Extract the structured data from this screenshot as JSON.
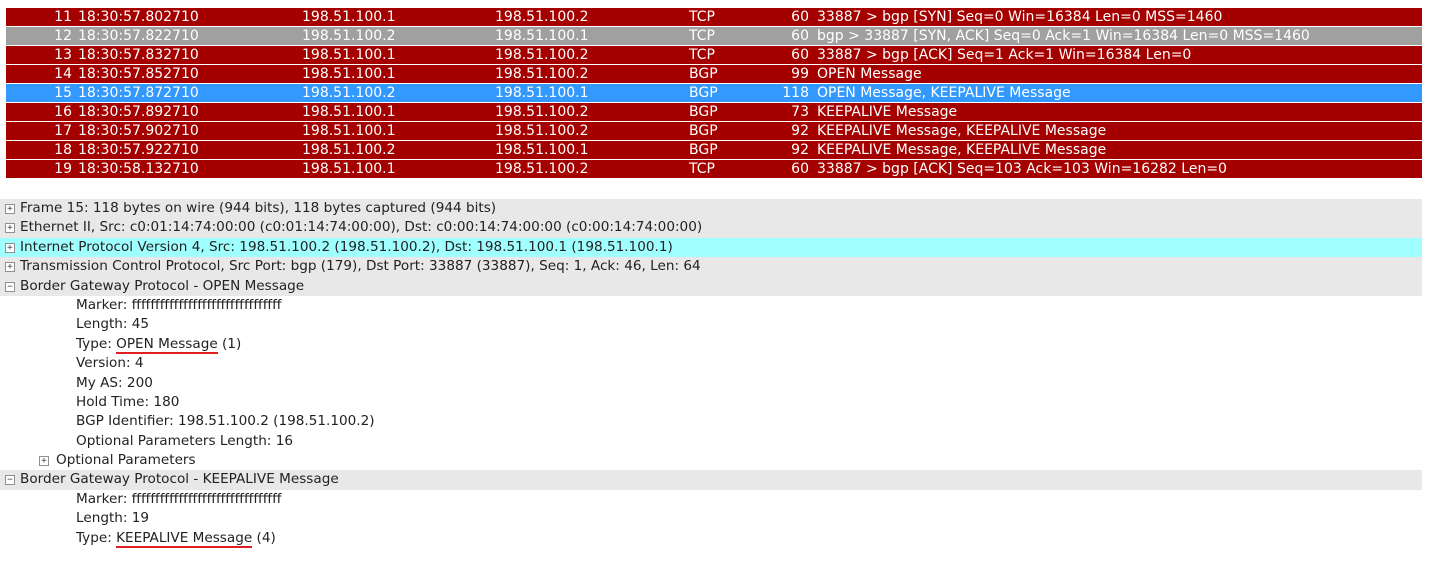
{
  "packets": [
    {
      "no": "11",
      "time": "18:30:57.802710",
      "src": "198.51.100.1",
      "dst": "198.51.100.2",
      "proto": "TCP",
      "len": "60",
      "info": "33887 > bgp [SYN] Seq=0 Win=16384 Len=0 MSS=1460"
    },
    {
      "no": "12",
      "time": "18:30:57.822710",
      "src": "198.51.100.2",
      "dst": "198.51.100.1",
      "proto": "TCP",
      "len": "60",
      "info": "bgp > 33887 [SYN, ACK] Seq=0 Ack=1 Win=16384 Len=0 MSS=1460"
    },
    {
      "no": "13",
      "time": "18:30:57.832710",
      "src": "198.51.100.1",
      "dst": "198.51.100.2",
      "proto": "TCP",
      "len": "60",
      "info": "33887 > bgp [ACK] Seq=1 Ack=1 Win=16384 Len=0"
    },
    {
      "no": "14",
      "time": "18:30:57.852710",
      "src": "198.51.100.1",
      "dst": "198.51.100.2",
      "proto": "BGP",
      "len": "99",
      "info": "OPEN Message"
    },
    {
      "no": "15",
      "time": "18:30:57.872710",
      "src": "198.51.100.2",
      "dst": "198.51.100.1",
      "proto": "BGP",
      "len": "118",
      "info": "OPEN Message, KEEPALIVE Message"
    },
    {
      "no": "16",
      "time": "18:30:57.892710",
      "src": "198.51.100.1",
      "dst": "198.51.100.2",
      "proto": "BGP",
      "len": "73",
      "info": "KEEPALIVE Message"
    },
    {
      "no": "17",
      "time": "18:30:57.902710",
      "src": "198.51.100.1",
      "dst": "198.51.100.2",
      "proto": "BGP",
      "len": "92",
      "info": "KEEPALIVE Message, KEEPALIVE Message"
    },
    {
      "no": "18",
      "time": "18:30:57.922710",
      "src": "198.51.100.2",
      "dst": "198.51.100.1",
      "proto": "BGP",
      "len": "92",
      "info": "KEEPALIVE Message, KEEPALIVE Message"
    },
    {
      "no": "19",
      "time": "18:30:58.132710",
      "src": "198.51.100.1",
      "dst": "198.51.100.2",
      "proto": "TCP",
      "len": "60",
      "info": "33887 > bgp [ACK] Seq=103 Ack=103 Win=16282 Len=0"
    }
  ],
  "row_colors": {
    "default": "#a40000",
    "ack_reply": "#a0a0a0",
    "selected": "#3399ff"
  },
  "selected_packet": "15",
  "details": {
    "frame": "Frame 15: 118 bytes on wire (944 bits), 118 bytes captured (944 bits)",
    "ethernet": "Ethernet II, Src: c0:01:14:74:00:00 (c0:01:14:74:00:00), Dst: c0:00:14:74:00:00 (c0:00:14:74:00:00)",
    "ip": "Internet Protocol Version 4, Src: 198.51.100.2 (198.51.100.2), Dst: 198.51.100.1 (198.51.100.1)",
    "tcp": "Transmission Control Protocol, Src Port: bgp (179), Dst Port: 33887 (33887), Seq: 1, Ack: 46, Len: 64",
    "bgp_open": {
      "title": "Border Gateway Protocol - OPEN Message",
      "marker": "Marker: ffffffffffffffffffffffffffffffff",
      "length": "Length: 45",
      "type_prefix": "Type: ",
      "type_value": "OPEN Message",
      "type_suffix": " (1)",
      "version": "Version: 4",
      "my_as": "My AS: 200",
      "hold_time": "Hold Time: 180",
      "bgp_identifier": "BGP Identifier: 198.51.100.2 (198.51.100.2)",
      "opt_params_length": "Optional Parameters Length: 16",
      "opt_params": "Optional Parameters"
    },
    "bgp_keepalive": {
      "title": "Border Gateway Protocol - KEEPALIVE Message",
      "marker": "Marker: ffffffffffffffffffffffffffffffff",
      "length": "Length: 19",
      "type_prefix": "Type: ",
      "type_value": "KEEPALIVE Message",
      "type_suffix": " (4)"
    }
  },
  "icons": {
    "collapsed": "plus-box-icon",
    "expanded": "minus-box-icon"
  }
}
